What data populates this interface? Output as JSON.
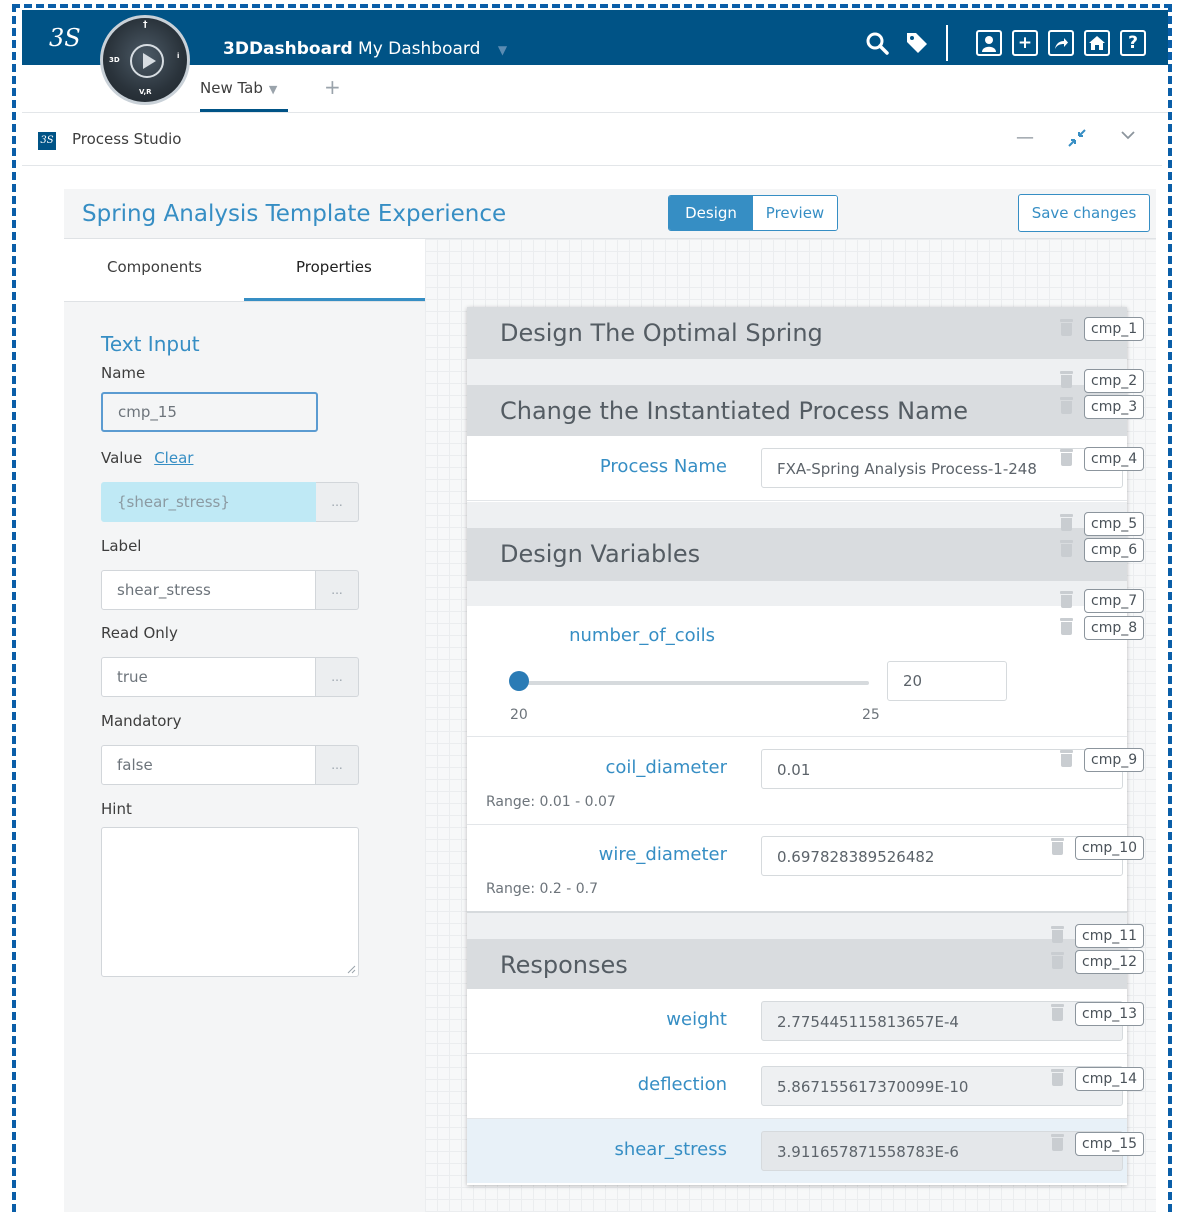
{
  "topbar": {
    "brand_bold": "3DDashboard",
    "brand_rest": "My Dashboard",
    "compass": {
      "left": "3D",
      "right": "i",
      "bottom": "V,R",
      "top": "†"
    }
  },
  "tabs": {
    "new_tab": "New Tab"
  },
  "widget": {
    "title": "Process Studio"
  },
  "app": {
    "title": "Spring Analysis Template Experience",
    "mode_design": "Design",
    "mode_preview": "Preview",
    "save": "Save changes"
  },
  "left_panel": {
    "tab_components": "Components",
    "tab_properties": "Properties",
    "section_title": "Text Input",
    "name_label": "Name",
    "name_value": "cmp_15",
    "value_label": "Value",
    "clear_link": "Clear",
    "value_value": "{shear_stress}",
    "label_label": "Label",
    "label_value": "shear_stress",
    "readonly_label": "Read Only",
    "readonly_value": "true",
    "mandatory_label": "Mandatory",
    "mandatory_value": "false",
    "hint_label": "Hint",
    "dots": "..."
  },
  "form": {
    "sec_design": "Design The Optimal Spring",
    "sec_change": "Change the Instantiated Process Name",
    "process_name_label": "Process Name",
    "process_name_value": "FXA-Spring Analysis Process-1-248",
    "sec_variables": "Design Variables",
    "coils_label": "number_of_coils",
    "coils_value": "20",
    "coils_min": "20",
    "coils_max": "25",
    "coils_level": 0.0,
    "coil_diameter_label": "coil_diameter",
    "coil_diameter_value": "0.01",
    "coil_diameter_range": "Range: 0.01 - 0.07",
    "wire_diameter_label": "wire_diameter",
    "wire_diameter_value": "0.697828389526482",
    "wire_diameter_range": "Range: 0.2 - 0.7",
    "sec_responses": "Responses",
    "weight_label": "weight",
    "weight_value": "2.775445115813657E-4",
    "deflection_label": "deflection",
    "deflection_value": "5.867155617370099E-10",
    "shear_label": "shear_stress",
    "shear_value": "3.911657871558783E-6"
  },
  "cmp_tags": [
    "cmp_1",
    "cmp_2",
    "cmp_3",
    "cmp_4",
    "cmp_5",
    "cmp_6",
    "cmp_7",
    "cmp_8",
    "cmp_9",
    "cmp_10",
    "cmp_11",
    "cmp_12",
    "cmp_13",
    "cmp_14",
    "cmp_15"
  ],
  "colors": {
    "topbar": "#005386",
    "accent": "#368ec4",
    "selected_row": "#e8f1f8"
  }
}
